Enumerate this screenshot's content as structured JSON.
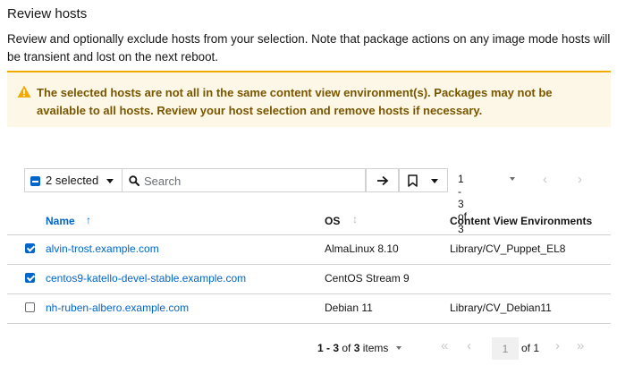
{
  "title": "Review hosts",
  "description": "Review and optionally exclude hosts from your selection. Note that package actions on any image mode hosts will be transient and lost on the next reboot.",
  "alert": {
    "text": "The selected hosts are not all in the same content view environment(s). Packages may not be available to all hosts. Review your host selection and remove hosts if necessary.",
    "icon": "warning-triangle-icon",
    "color": "#795600",
    "background": "#fdf7e7",
    "border": "#f0ab00"
  },
  "toolbar": {
    "bulk_select_label": "2 selected",
    "search_placeholder": "Search",
    "search_value": "",
    "pagination_label": "1 - 3 of 3"
  },
  "table": {
    "columns": {
      "name": "Name",
      "os": "OS",
      "cve": "Content View Environments"
    },
    "rows": [
      {
        "checked": true,
        "name": "alvin-trost.example.com",
        "os": "AlmaLinux 8.10",
        "cve": "Library/CV_Puppet_EL8"
      },
      {
        "checked": true,
        "name": "centos9-katello-devel-stable.example.com",
        "os": "CentOS Stream 9",
        "cve": ""
      },
      {
        "checked": false,
        "name": "nh-ruben-albero.example.com",
        "os": "Debian 11",
        "cve": "Library/CV_Debian11"
      }
    ]
  },
  "pagination": {
    "range": "1 - 3",
    "of_label": "of",
    "total": "3",
    "items_label": "items",
    "current_page": "1",
    "of_pages": "of 1"
  },
  "colors": {
    "link": "#0066cc",
    "checkbox": "#0066cc",
    "text": "#151515",
    "muted": "#6a6e73"
  }
}
